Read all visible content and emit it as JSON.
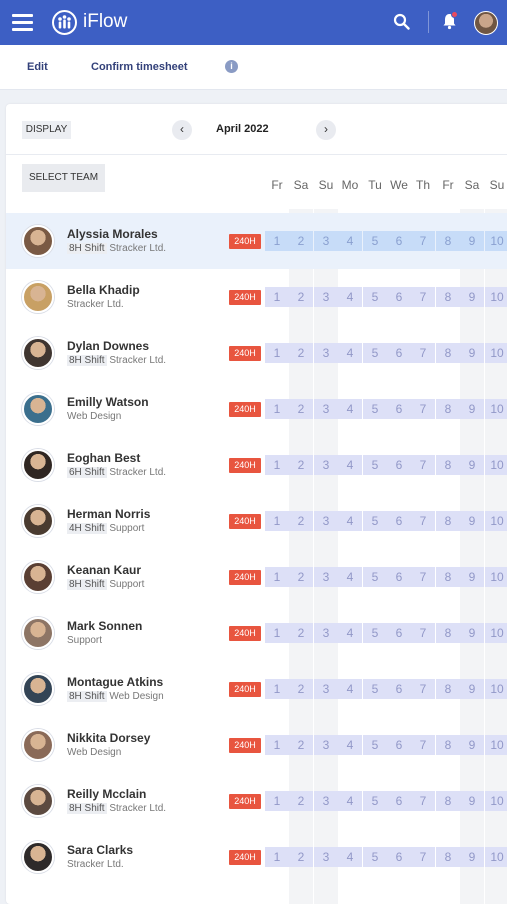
{
  "app": {
    "title": "iFlow"
  },
  "toolbar": {
    "edit": "Edit",
    "confirm": "Confirm timesheet",
    "info": "i"
  },
  "calendar": {
    "display_label": "DISPLAY",
    "month": "April 2022",
    "prev": "‹",
    "next": "›",
    "select_team": "SELECT TEAM",
    "days": [
      "Fr",
      "Sa",
      "Su",
      "Mo",
      "Tu",
      "We",
      "Th",
      "Fr",
      "Sa",
      "Su"
    ],
    "dates": [
      "1",
      "2",
      "3",
      "4",
      "5",
      "6",
      "7",
      "8",
      "9",
      "10"
    ]
  },
  "employees": [
    {
      "name": "Alyssia Morales",
      "shift": "8H Shift",
      "team": "Stracker Ltd.",
      "hours": "240H"
    },
    {
      "name": "Bella Khadip",
      "shift": "",
      "team": "Stracker Ltd.",
      "hours": "240H"
    },
    {
      "name": "Dylan Downes",
      "shift": "8H Shift",
      "team": "Stracker Ltd.",
      "hours": "240H"
    },
    {
      "name": "Emilly Watson",
      "shift": "",
      "team": "Web Design",
      "hours": "240H"
    },
    {
      "name": "Eoghan Best",
      "shift": "6H Shift",
      "team": "Stracker Ltd.",
      "hours": "240H"
    },
    {
      "name": "Herman Norris",
      "shift": "4H Shift",
      "team": "Support",
      "hours": "240H"
    },
    {
      "name": "Keanan Kaur",
      "shift": "8H Shift",
      "team": "Support",
      "hours": "240H"
    },
    {
      "name": "Mark Sonnen",
      "shift": "",
      "team": "Support",
      "hours": "240H"
    },
    {
      "name": "Montague Atkins",
      "shift": "8H Shift",
      "team": "Web Design",
      "hours": "240H"
    },
    {
      "name": "Nikkita Dorsey",
      "shift": "",
      "team": "Web Design",
      "hours": "240H"
    },
    {
      "name": "Reilly Mcclain",
      "shift": "8H Shift",
      "team": "Stracker Ltd.",
      "hours": "240H"
    },
    {
      "name": "Sara Clarks",
      "shift": "",
      "team": "Stracker Ltd.",
      "hours": "240H"
    }
  ],
  "colors": {
    "accent": "#3d5fc4",
    "hours_badge": "#e8553f",
    "selected_row": "#eaf1fb",
    "day_cell": "#dde0f7"
  }
}
